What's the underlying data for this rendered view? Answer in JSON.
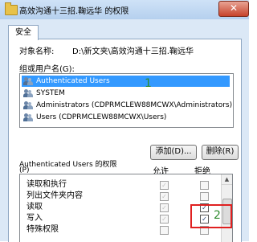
{
  "window": {
    "title": "高效沟通十三招.鞠远华 的权限",
    "close_glyph": "✕"
  },
  "tab": {
    "label": "安全"
  },
  "object": {
    "label": "对象名称:",
    "value": "D:\\新文夹\\高效沟通十三招.鞠远华"
  },
  "groups": {
    "label": "组或用户名(G):",
    "items": [
      {
        "name": "Authenticated Users",
        "selected": true
      },
      {
        "name": "SYSTEM",
        "selected": false
      },
      {
        "name": "Administrators (CDPRMCLEW88MCWX\\Administrators)",
        "selected": false
      },
      {
        "name": "Users (CDPRMCLEW88MCWX\\Users)",
        "selected": false
      }
    ],
    "annotation": "1"
  },
  "buttons": {
    "add": "添加(D)...",
    "remove": "删除(R)"
  },
  "permissions": {
    "header_line1": "Authenticated Users 的权限",
    "header_line2": "(P)",
    "allow_header": "允许",
    "deny_header": "拒绝",
    "rows": [
      {
        "name": "读取和执行",
        "allow": true,
        "deny": false
      },
      {
        "name": "列出文件夹内容",
        "allow": true,
        "deny": false
      },
      {
        "name": "读取",
        "allow": true,
        "deny": true
      },
      {
        "name": "写入",
        "allow": true,
        "deny": true
      },
      {
        "name": "特殊权限",
        "allow": false,
        "deny": false
      }
    ],
    "annotation": "2",
    "check_glyph": "✓",
    "scroll_up_glyph": "▲"
  }
}
